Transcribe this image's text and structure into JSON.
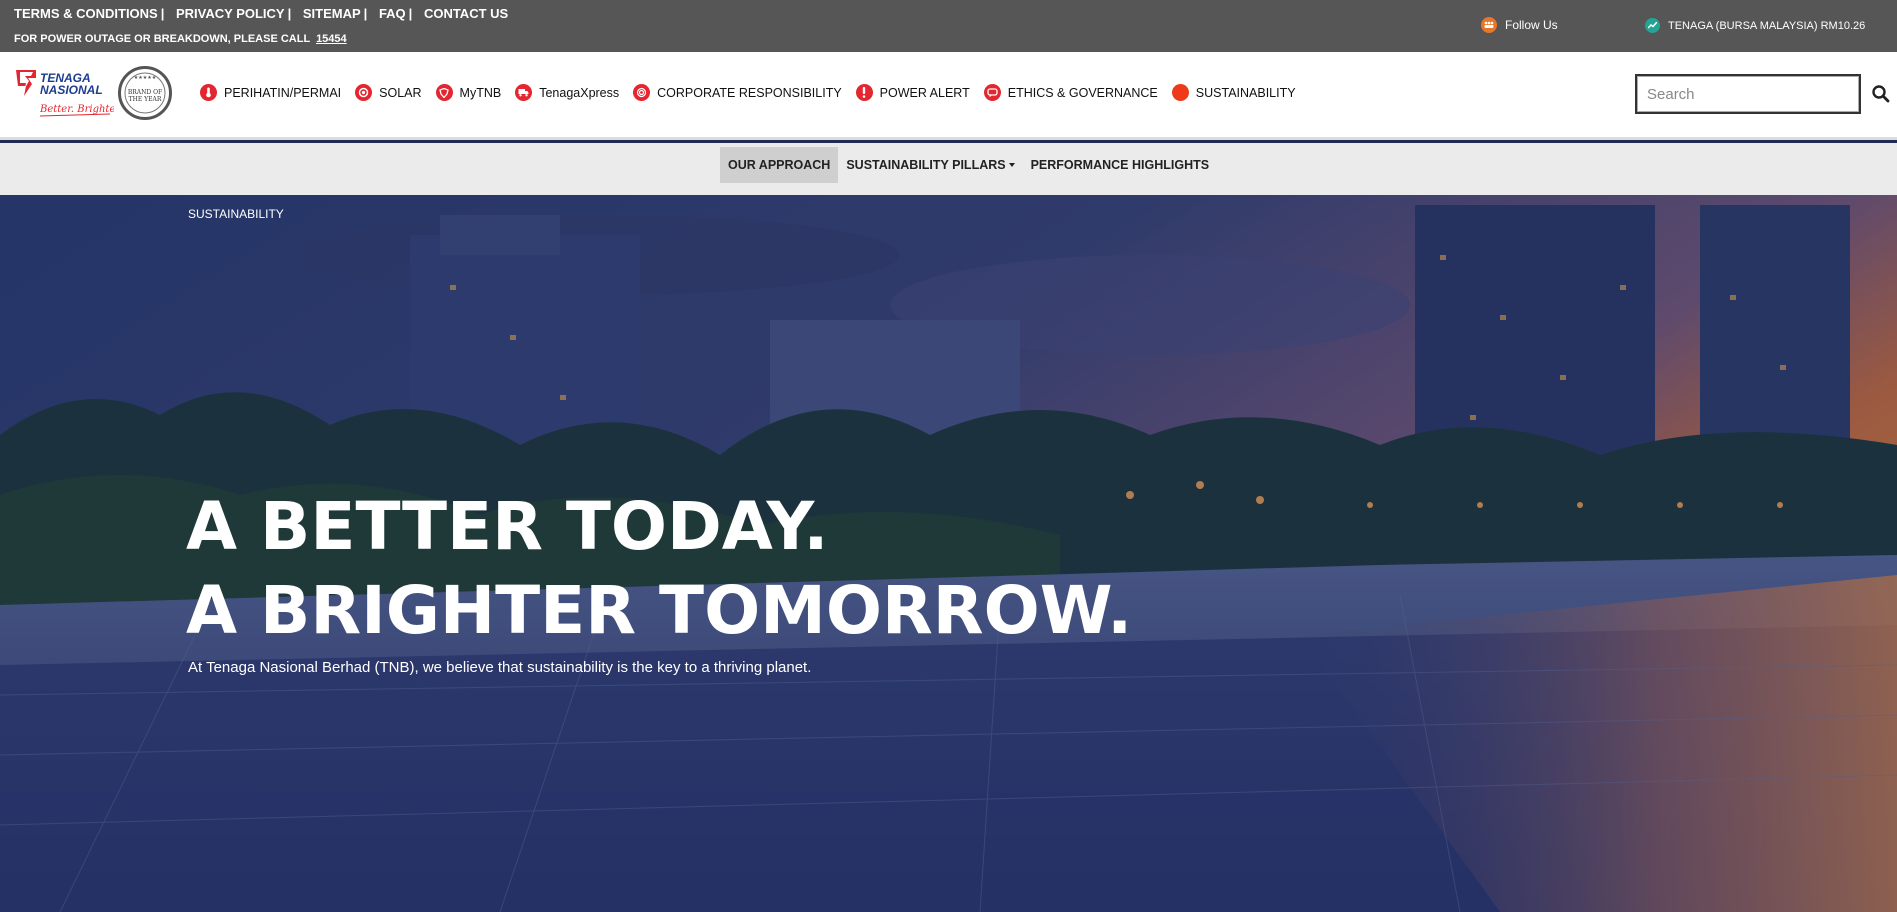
{
  "topbar": {
    "links": [
      "TERMS & CONDITIONS",
      "PRIVACY POLICY",
      "SITEMAP",
      "FAQ",
      "CONTACT US"
    ],
    "outage_text": "FOR POWER OUTAGE OR BREAKDOWN, PLEASE CALL",
    "outage_phone": "15454",
    "follow_label": "Follow Us",
    "stock_label": "TENAGA (BURSA MALAYSIA) RM10.26"
  },
  "brand": {
    "logo_line1": "TENAGA",
    "logo_line2": "NASIONAL",
    "logo_tagline": "Better. Brighter.",
    "seal_text": "BRAND OF THE YEAR",
    "brand_red": "#e3262f"
  },
  "nav": {
    "items": [
      {
        "label": "PERIHATIN/PERMAI",
        "icon": "thermometer-icon"
      },
      {
        "label": "SOLAR",
        "icon": "sun-icon"
      },
      {
        "label": "MyTNB",
        "icon": "shield-icon"
      },
      {
        "label": "TenagaXpress",
        "icon": "truck-icon"
      },
      {
        "label": "CORPORATE RESPONSIBILITY",
        "icon": "target-icon"
      },
      {
        "label": "POWER ALERT",
        "icon": "alert-icon"
      },
      {
        "label": "ETHICS & GOVERNANCE",
        "icon": "chat-icon"
      },
      {
        "label": "SUSTAINABILITY",
        "icon": "circle-icon"
      }
    ],
    "search_placeholder": "Search"
  },
  "subnav": {
    "items": [
      "OUR APPROACH",
      "SUSTAINABILITY PILLARS",
      "PERFORMANCE HIGHLIGHTS"
    ],
    "active": "OUR APPROACH"
  },
  "hero": {
    "breadcrumb": "SUSTAINABILITY",
    "headline_line1": "A BETTER TODAY.",
    "headline_line2": "A BRIGHTER TOMORROW.",
    "intro": "At Tenaga Nasional Berhad (TNB), we believe that sustainability is the key to a thriving planet."
  }
}
